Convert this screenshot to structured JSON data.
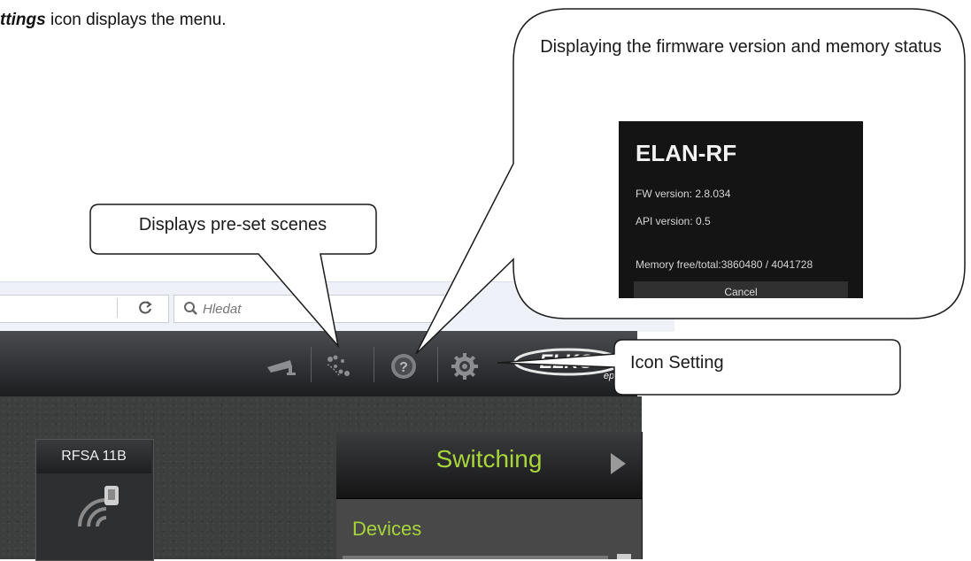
{
  "intro": {
    "bold_word": "ttings",
    "rest": " icon displays the menu."
  },
  "browser": {
    "reload_glyph": "C",
    "search_placeholder": "Hledat"
  },
  "header": {
    "icons": [
      "camera-icon",
      "scenes-icon",
      "help-icon",
      "settings-gear-icon"
    ],
    "logo_text": "ELKO",
    "logo_sub": "ep"
  },
  "device_tile": {
    "name": "RFSA 11B"
  },
  "panel": {
    "title": "Switching",
    "section": "Devices"
  },
  "callouts": {
    "firmware": {
      "title": "Displaying the firmware version and memory status",
      "device_name": "ELAN-RF",
      "fw_version": "FW version: 2.8.034",
      "api_version": "API version: 0.5",
      "memory": "Memory free/total:3860480 / 4041728",
      "cancel": "Cancel"
    },
    "scenes": "Displays pre-set scenes",
    "setting": "Icon Setting"
  },
  "colors": {
    "accent_green": "#a7d63b",
    "header_dark": "#2a2b2e",
    "body_texture": "#3d3e3e"
  }
}
